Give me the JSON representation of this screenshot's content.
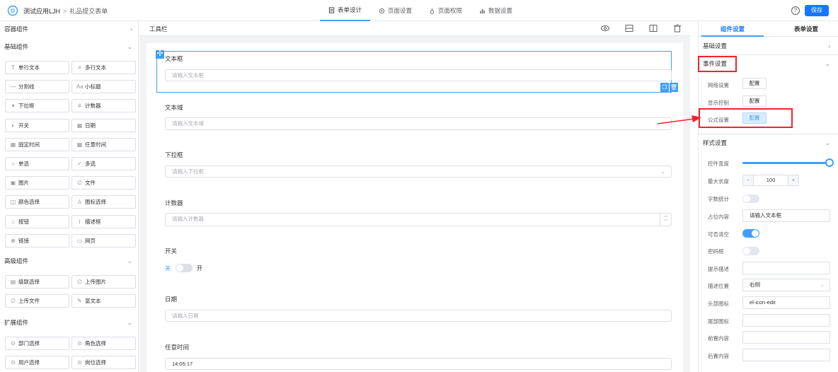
{
  "topbar": {
    "app_name": "测试应用LJH",
    "separator": ">",
    "form_name": "礼品提交表单",
    "tabs": [
      {
        "label": "表单设计",
        "icon": "form-design-icon",
        "active": true
      },
      {
        "label": "页面设置",
        "icon": "page-settings-icon",
        "active": false
      },
      {
        "label": "页面权限",
        "icon": "page-permission-icon",
        "active": false
      },
      {
        "label": "数据设置",
        "icon": "data-settings-icon",
        "active": false
      }
    ],
    "help_icon": "?",
    "save_label": "保存"
  },
  "left": {
    "container_section": "容器组件",
    "basic_section": "基础组件",
    "basic_items": [
      {
        "label": "单行文本",
        "glyph": "T"
      },
      {
        "label": "多行文本",
        "glyph": "≡"
      },
      {
        "label": "分割线",
        "glyph": "—"
      },
      {
        "label": "小标题",
        "glyph": "Aa"
      },
      {
        "label": "下拉框",
        "glyph": "▾"
      },
      {
        "label": "计数器",
        "glyph": "#"
      },
      {
        "label": "开关",
        "glyph": "◐"
      },
      {
        "label": "日期",
        "glyph": "▦"
      },
      {
        "label": "固定时间",
        "glyph": "▦"
      },
      {
        "label": "任意时间",
        "glyph": "▦"
      },
      {
        "label": "单选",
        "glyph": "○"
      },
      {
        "label": "多选",
        "glyph": "✓"
      },
      {
        "label": "图片",
        "glyph": "▣"
      },
      {
        "label": "文件",
        "glyph": "∅"
      },
      {
        "label": "颜色选择",
        "glyph": "◫"
      },
      {
        "label": "图标选择",
        "glyph": "♙"
      },
      {
        "label": "按钮",
        "glyph": "⌂"
      },
      {
        "label": "描述框",
        "glyph": "i"
      },
      {
        "label": "链接",
        "glyph": "⊕"
      },
      {
        "label": "网页",
        "glyph": "▭"
      }
    ],
    "advanced_section": "高级组件",
    "advanced_items": [
      {
        "label": "级联选择",
        "glyph": "▤"
      },
      {
        "label": "上传图片",
        "glyph": "∅"
      },
      {
        "label": "上传文件",
        "glyph": "∅"
      },
      {
        "label": "富文本",
        "glyph": "✎"
      }
    ],
    "extended_section": "扩展组件",
    "extended_items": [
      {
        "label": "部门选择",
        "glyph": "⊙"
      },
      {
        "label": "角色选择",
        "glyph": "⊙"
      },
      {
        "label": "用户选择",
        "glyph": "⊙"
      },
      {
        "label": "岗位选择",
        "glyph": "⊙"
      }
    ]
  },
  "middle": {
    "toolbar_label": "工具栏",
    "fields": {
      "textbox_label": "文本框",
      "textbox_placeholder": "请输入文本框",
      "textarea_label": "文本域",
      "textarea_placeholder": "请输入文本域",
      "select_label": "下拉框",
      "select_placeholder": "请输入下拉框",
      "counter_label": "计数器",
      "counter_placeholder": "请输入计数器",
      "switch_label": "开关",
      "switch_off": "关",
      "switch_on": "开",
      "date_label": "日期",
      "date_placeholder": "请输入日期",
      "anytime_label": "任意时间",
      "anytime_value": "14:05:17"
    }
  },
  "right": {
    "tab_component": "组件设置",
    "tab_form": "表单设置",
    "basic_settings": "基础设置",
    "event_settings": "事件设置",
    "network_label": "网络设置",
    "display_label": "显示控制",
    "formula_label": "公式设置",
    "config_label": "配置",
    "style_settings": "样式设置",
    "style_rows": {
      "width_label": "控件宽度",
      "width_value": 1.0,
      "maxlen_label": "最大长度",
      "maxlen_value": "100",
      "minus": "−",
      "plus": "+",
      "wordcount_label": "字数统计",
      "placeholder_label": "占位内容",
      "placeholder_value": "请输入文本框",
      "clearable_label": "可否清空",
      "password_label": "密码框",
      "hint_label": "提示描述",
      "desc_pos_label": "描述位置",
      "desc_pos_value": "右侧",
      "head_icon_label": "头部图标",
      "head_icon_value": "el-icon-edit",
      "tail_icon_label": "尾部图标",
      "prefix_label": "前置内容",
      "suffix_label": "后置内容"
    }
  },
  "colors": {
    "accent": "#409eff",
    "save": "#1677ff",
    "annotation": "#f5222d"
  }
}
